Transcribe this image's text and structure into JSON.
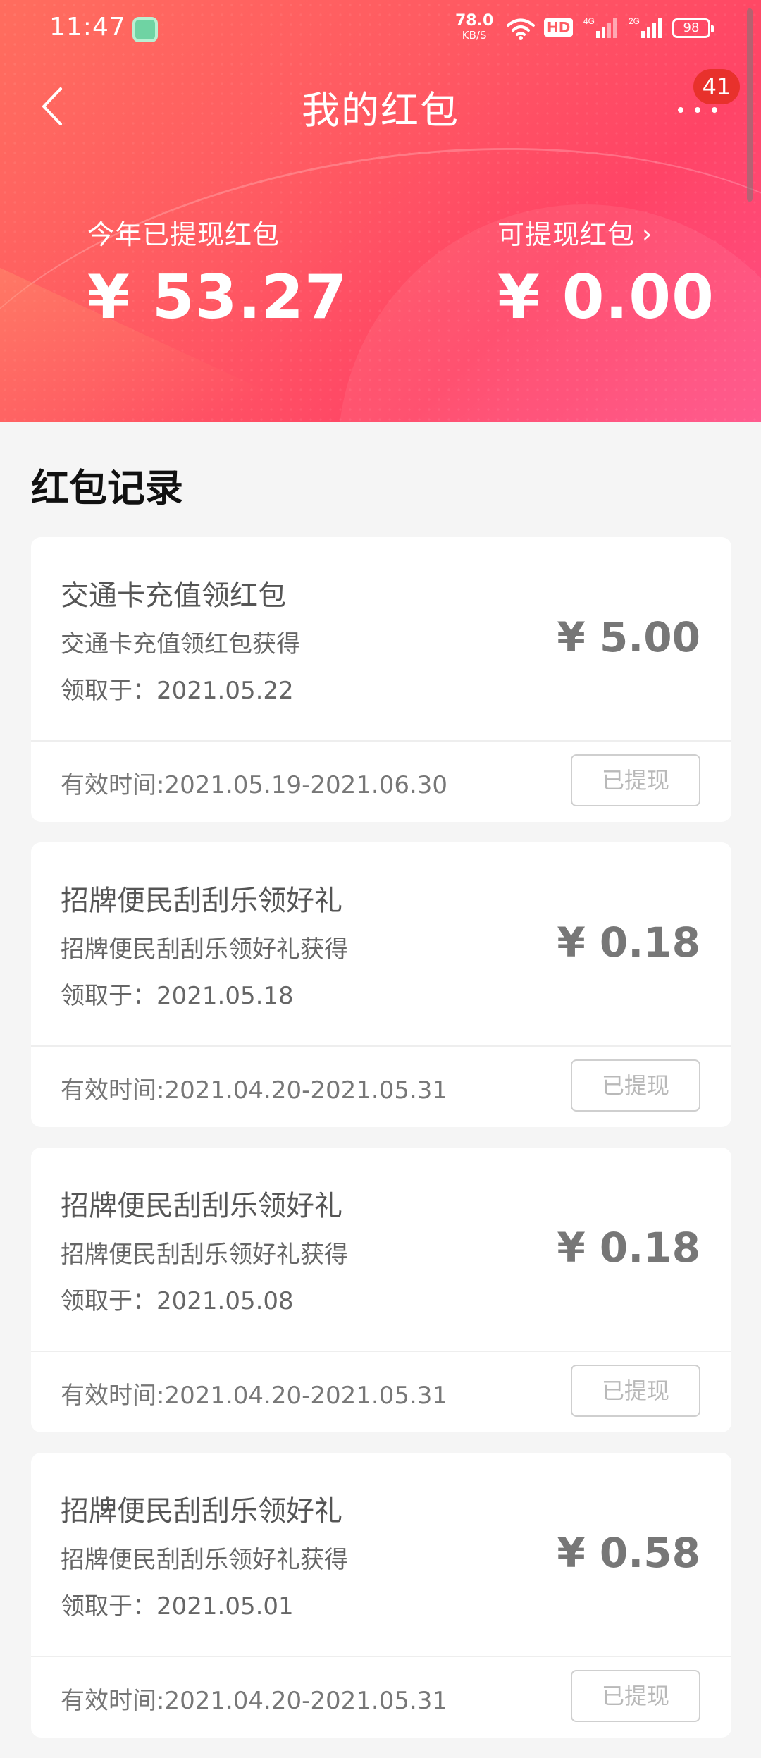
{
  "status_bar": {
    "time": "11:47",
    "net_speed": "78.0",
    "net_unit": "KB/S",
    "hd": "HD",
    "signal1": "4G",
    "signal2": "2G",
    "battery": "98"
  },
  "nav": {
    "title": "我的红包",
    "more_badge": "41"
  },
  "summary": {
    "withdrawn_label": "今年已提现红包",
    "withdrawn_value": "¥ 53.27",
    "available_label": "可提现红包",
    "available_value": "¥ 0.00"
  },
  "section_title": "红包记录",
  "records": [
    {
      "title": "交通卡充值领红包",
      "subtitle": "交通卡充值领红包获得",
      "date": "领取于：2021.05.22",
      "amount": "¥ 5.00",
      "valid": "有效时间:2021.05.19-2021.06.30",
      "button": "已提现"
    },
    {
      "title": "招牌便民刮刮乐领好礼",
      "subtitle": "招牌便民刮刮乐领好礼获得",
      "date": "领取于：2021.05.18",
      "amount": "¥ 0.18",
      "valid": "有效时间:2021.04.20-2021.05.31",
      "button": "已提现"
    },
    {
      "title": "招牌便民刮刮乐领好礼",
      "subtitle": "招牌便民刮刮乐领好礼获得",
      "date": "领取于：2021.05.08",
      "amount": "¥ 0.18",
      "valid": "有效时间:2021.04.20-2021.05.31",
      "button": "已提现"
    },
    {
      "title": "招牌便民刮刮乐领好礼",
      "subtitle": "招牌便民刮刮乐领好礼获得",
      "date": "领取于：2021.05.01",
      "amount": "¥ 0.58",
      "valid": "有效时间:2021.04.20-2021.05.31",
      "button": "已提现"
    }
  ],
  "colors": {
    "header_start": "#ff6d5e",
    "header_end": "#ff4f86",
    "badge": "#e8312c",
    "page_bg": "#f5f5f5"
  }
}
